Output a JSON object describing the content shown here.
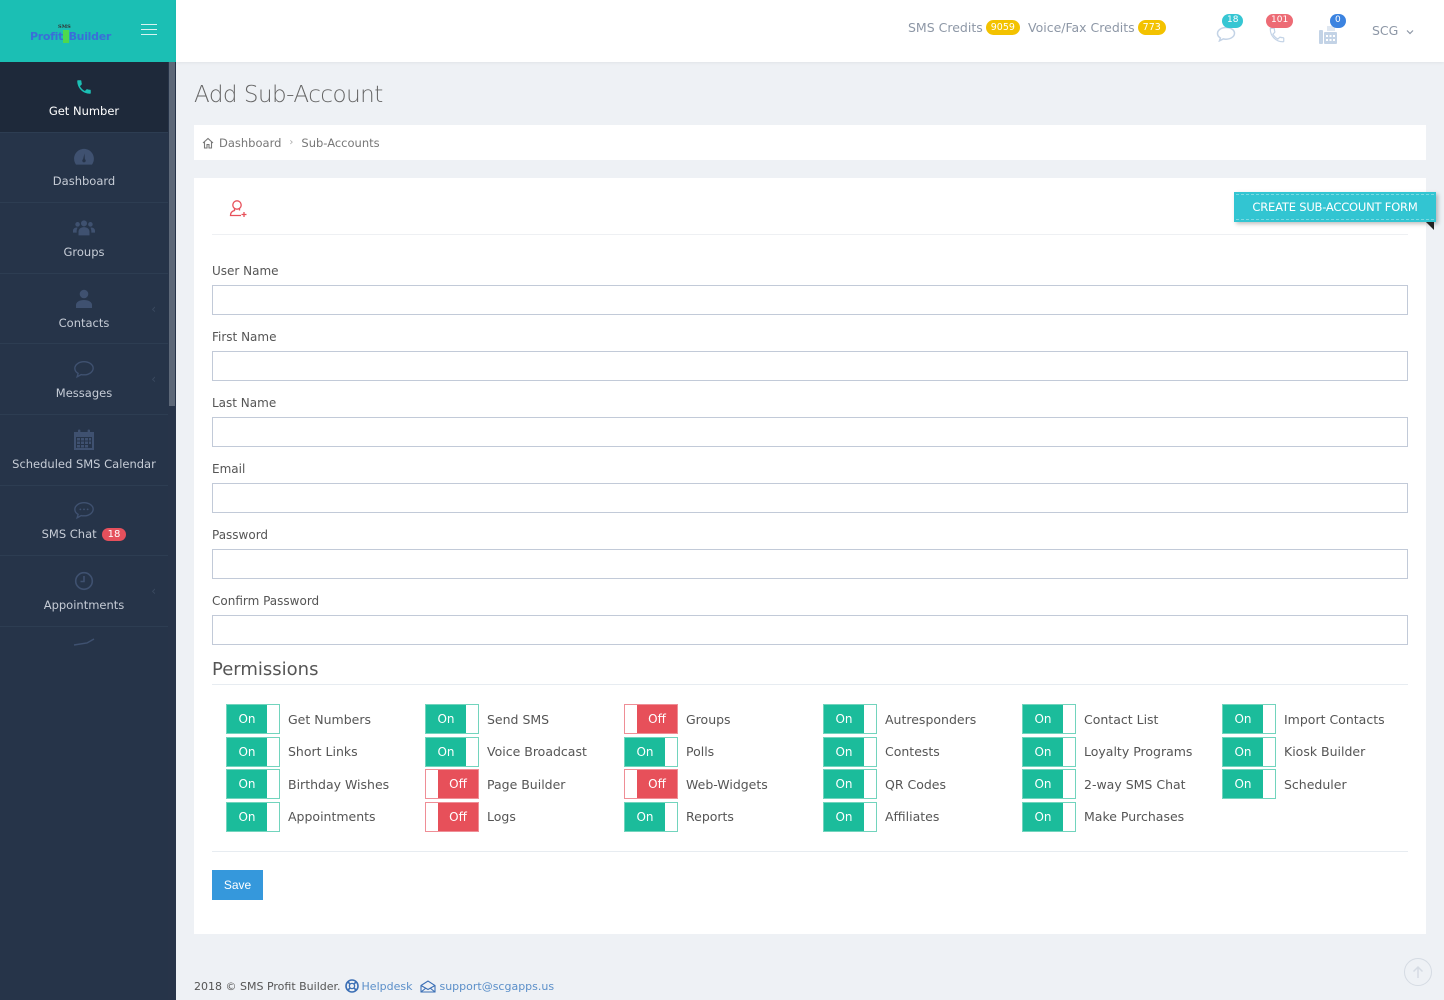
{
  "brand": {
    "small": "SMS",
    "name_part1": "Profit",
    "name_part2": "Builder"
  },
  "sidebar": {
    "items": [
      {
        "label": "Get Number",
        "icon": "phone-icon",
        "active": true
      },
      {
        "label": "Dashboard",
        "icon": "dashboard-gauge-icon"
      },
      {
        "label": "Groups",
        "icon": "groups-icon"
      },
      {
        "label": "Contacts",
        "icon": "contact-icon",
        "has_submenu": true
      },
      {
        "label": "Messages",
        "icon": "message-bubble-icon",
        "has_submenu": true
      },
      {
        "label": "Scheduled SMS Calendar",
        "icon": "calendar-icon"
      },
      {
        "label": "SMS Chat",
        "icon": "chat-icon",
        "badge": "18"
      },
      {
        "label": "Appointments",
        "icon": "clock-icon",
        "has_submenu": true
      }
    ],
    "submenu_chevron": "‹"
  },
  "topbar": {
    "sms_credits_label": "SMS Credits",
    "sms_credits_value": "9059",
    "voice_credits_label": "Voice/Fax Credits",
    "voice_credits_value": "773",
    "chat_count": "18",
    "call_count": "101",
    "fax_count": "0",
    "user": "SCG",
    "user_chevron": "⌄"
  },
  "page": {
    "title": "Add Sub-Account",
    "breadcrumb": [
      "Dashboard",
      "Sub-Accounts"
    ],
    "breadcrumb_sep": "›",
    "ribbon": "CREATE SUB-ACCOUNT FORM"
  },
  "form": {
    "fields": [
      {
        "label": "User Name",
        "value": "",
        "placeholder": ""
      },
      {
        "label": "First Name",
        "value": "",
        "placeholder": ""
      },
      {
        "label": "Last Name",
        "value": "",
        "placeholder": ""
      },
      {
        "label": "Email",
        "value": "",
        "placeholder": ""
      },
      {
        "label": "Password",
        "value": "",
        "placeholder": ""
      },
      {
        "label": "Confirm Password",
        "value": "",
        "placeholder": ""
      }
    ],
    "permissions_title": "Permissions",
    "on_label": "On",
    "off_label": "Off",
    "permissions": [
      [
        {
          "label": "Get Numbers",
          "on": true
        },
        {
          "label": "Short Links",
          "on": true
        },
        {
          "label": "Birthday Wishes",
          "on": true
        },
        {
          "label": "Appointments",
          "on": true
        }
      ],
      [
        {
          "label": "Send SMS",
          "on": true
        },
        {
          "label": "Voice Broadcast",
          "on": true
        },
        {
          "label": "Page Builder",
          "on": false
        },
        {
          "label": "Logs",
          "on": false
        }
      ],
      [
        {
          "label": "Groups",
          "on": false
        },
        {
          "label": "Polls",
          "on": true
        },
        {
          "label": "Web-Widgets",
          "on": false
        },
        {
          "label": "Reports",
          "on": true
        }
      ],
      [
        {
          "label": "Autresponders",
          "on": true
        },
        {
          "label": "Contests",
          "on": true
        },
        {
          "label": "QR Codes",
          "on": true
        },
        {
          "label": "Affiliates",
          "on": true
        }
      ],
      [
        {
          "label": "Contact List",
          "on": true
        },
        {
          "label": "Loyalty Programs",
          "on": true
        },
        {
          "label": "2-way SMS Chat",
          "on": true
        },
        {
          "label": "Make Purchases",
          "on": true
        }
      ],
      [
        {
          "label": "Import Contacts",
          "on": true
        },
        {
          "label": "Kiosk Builder",
          "on": true
        },
        {
          "label": "Scheduler",
          "on": true
        }
      ]
    ],
    "save_label": "Save"
  },
  "footer": {
    "copyright": "2018 © SMS Profit Builder.",
    "helpdesk": "Helpdesk",
    "email": "support@scgapps.us"
  },
  "colors": {
    "accent_teal": "#1bbfb4",
    "sidebar_bg": "#263449",
    "toggle_on": "#1bbc9b",
    "toggle_off": "#e7505a",
    "ribbon": "#32c5d2",
    "save": "#3598dc",
    "credits_badge": "#f3c200"
  }
}
